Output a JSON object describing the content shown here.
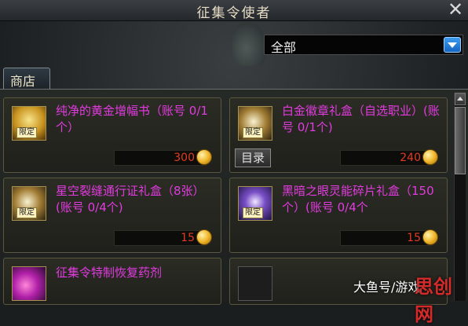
{
  "window": {
    "title": "征集令使者",
    "close_glyph": "✕"
  },
  "filter": {
    "selected": "全部"
  },
  "tabs": [
    {
      "label": "商店"
    }
  ],
  "items": [
    {
      "name": "纯净的黄金增幅书（账号 0/1个）",
      "price": "300",
      "badge": "限定",
      "icon": "gold-book-icon"
    },
    {
      "name": "白金徽章礼盒（自选职业）(账号 0/1个)",
      "price": "240",
      "badge": "限定",
      "icon": "gift-box-icon",
      "catalog_label": "目录"
    },
    {
      "name": "星空裂缝通行证礼盒（8张）(账号 0/4个)",
      "price": "15",
      "badge": "限定",
      "icon": "pass-box-icon"
    },
    {
      "name": "黑暗之眼灵能碎片礼盒（150个）(账号 0/4个",
      "price": "15",
      "badge": "限定",
      "icon": "crystal-box-icon"
    },
    {
      "name": "征集令特制恢复药剂",
      "icon": "potion-icon"
    }
  ],
  "watermark": {
    "text": "大鱼号/游戏",
    "brand": "思创网"
  },
  "colors": {
    "item_name": "#e23be0",
    "price": "#e23b1f",
    "accent": "#1e88e5"
  }
}
